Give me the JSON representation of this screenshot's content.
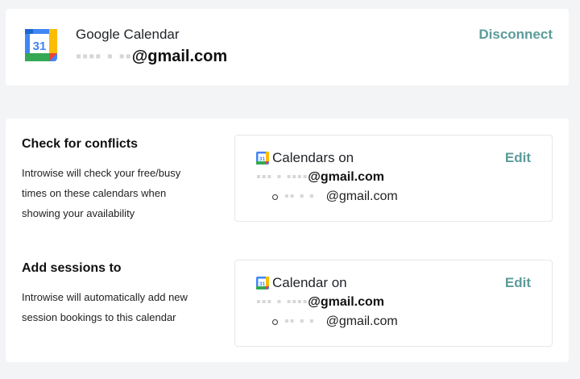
{
  "account": {
    "app_name": "Google Calendar",
    "logo_number": "31",
    "email_redacted": "▪▪▪▪ ▪ ▪▪",
    "email_domain": "@gmail.com",
    "disconnect_label": "Disconnect"
  },
  "conflicts": {
    "title": "Check for conflicts",
    "description": "Introwise will check your free/busy times on these calendars when showing your availability",
    "box_title": "Calendars on",
    "email_redacted": "▪▪▪ ▪ ▪▪▪▪",
    "email_domain": "@gmail.com",
    "list_item_redacted": "▪▪ ▪  ▪",
    "list_item_domain": "@gmail.com",
    "edit_label": "Edit",
    "mini_logo_number": "31"
  },
  "sessions": {
    "title": "Add sessions to",
    "description": "Introwise will automatically add new session bookings to this calendar",
    "box_title": "Calendar on",
    "email_redacted": "▪▪▪ ▪ ▪▪▪▪",
    "email_domain": "@gmail.com",
    "list_item_redacted": "▪▪ ▪  ▪",
    "list_item_domain": "@gmail.com",
    "edit_label": "Edit",
    "mini_logo_number": "31"
  },
  "colors": {
    "accent": "#5c9c99",
    "gcal_blue": "#4285f4",
    "gcal_green": "#34a853",
    "gcal_yellow": "#fbbc04",
    "gcal_red": "#ea4335"
  }
}
